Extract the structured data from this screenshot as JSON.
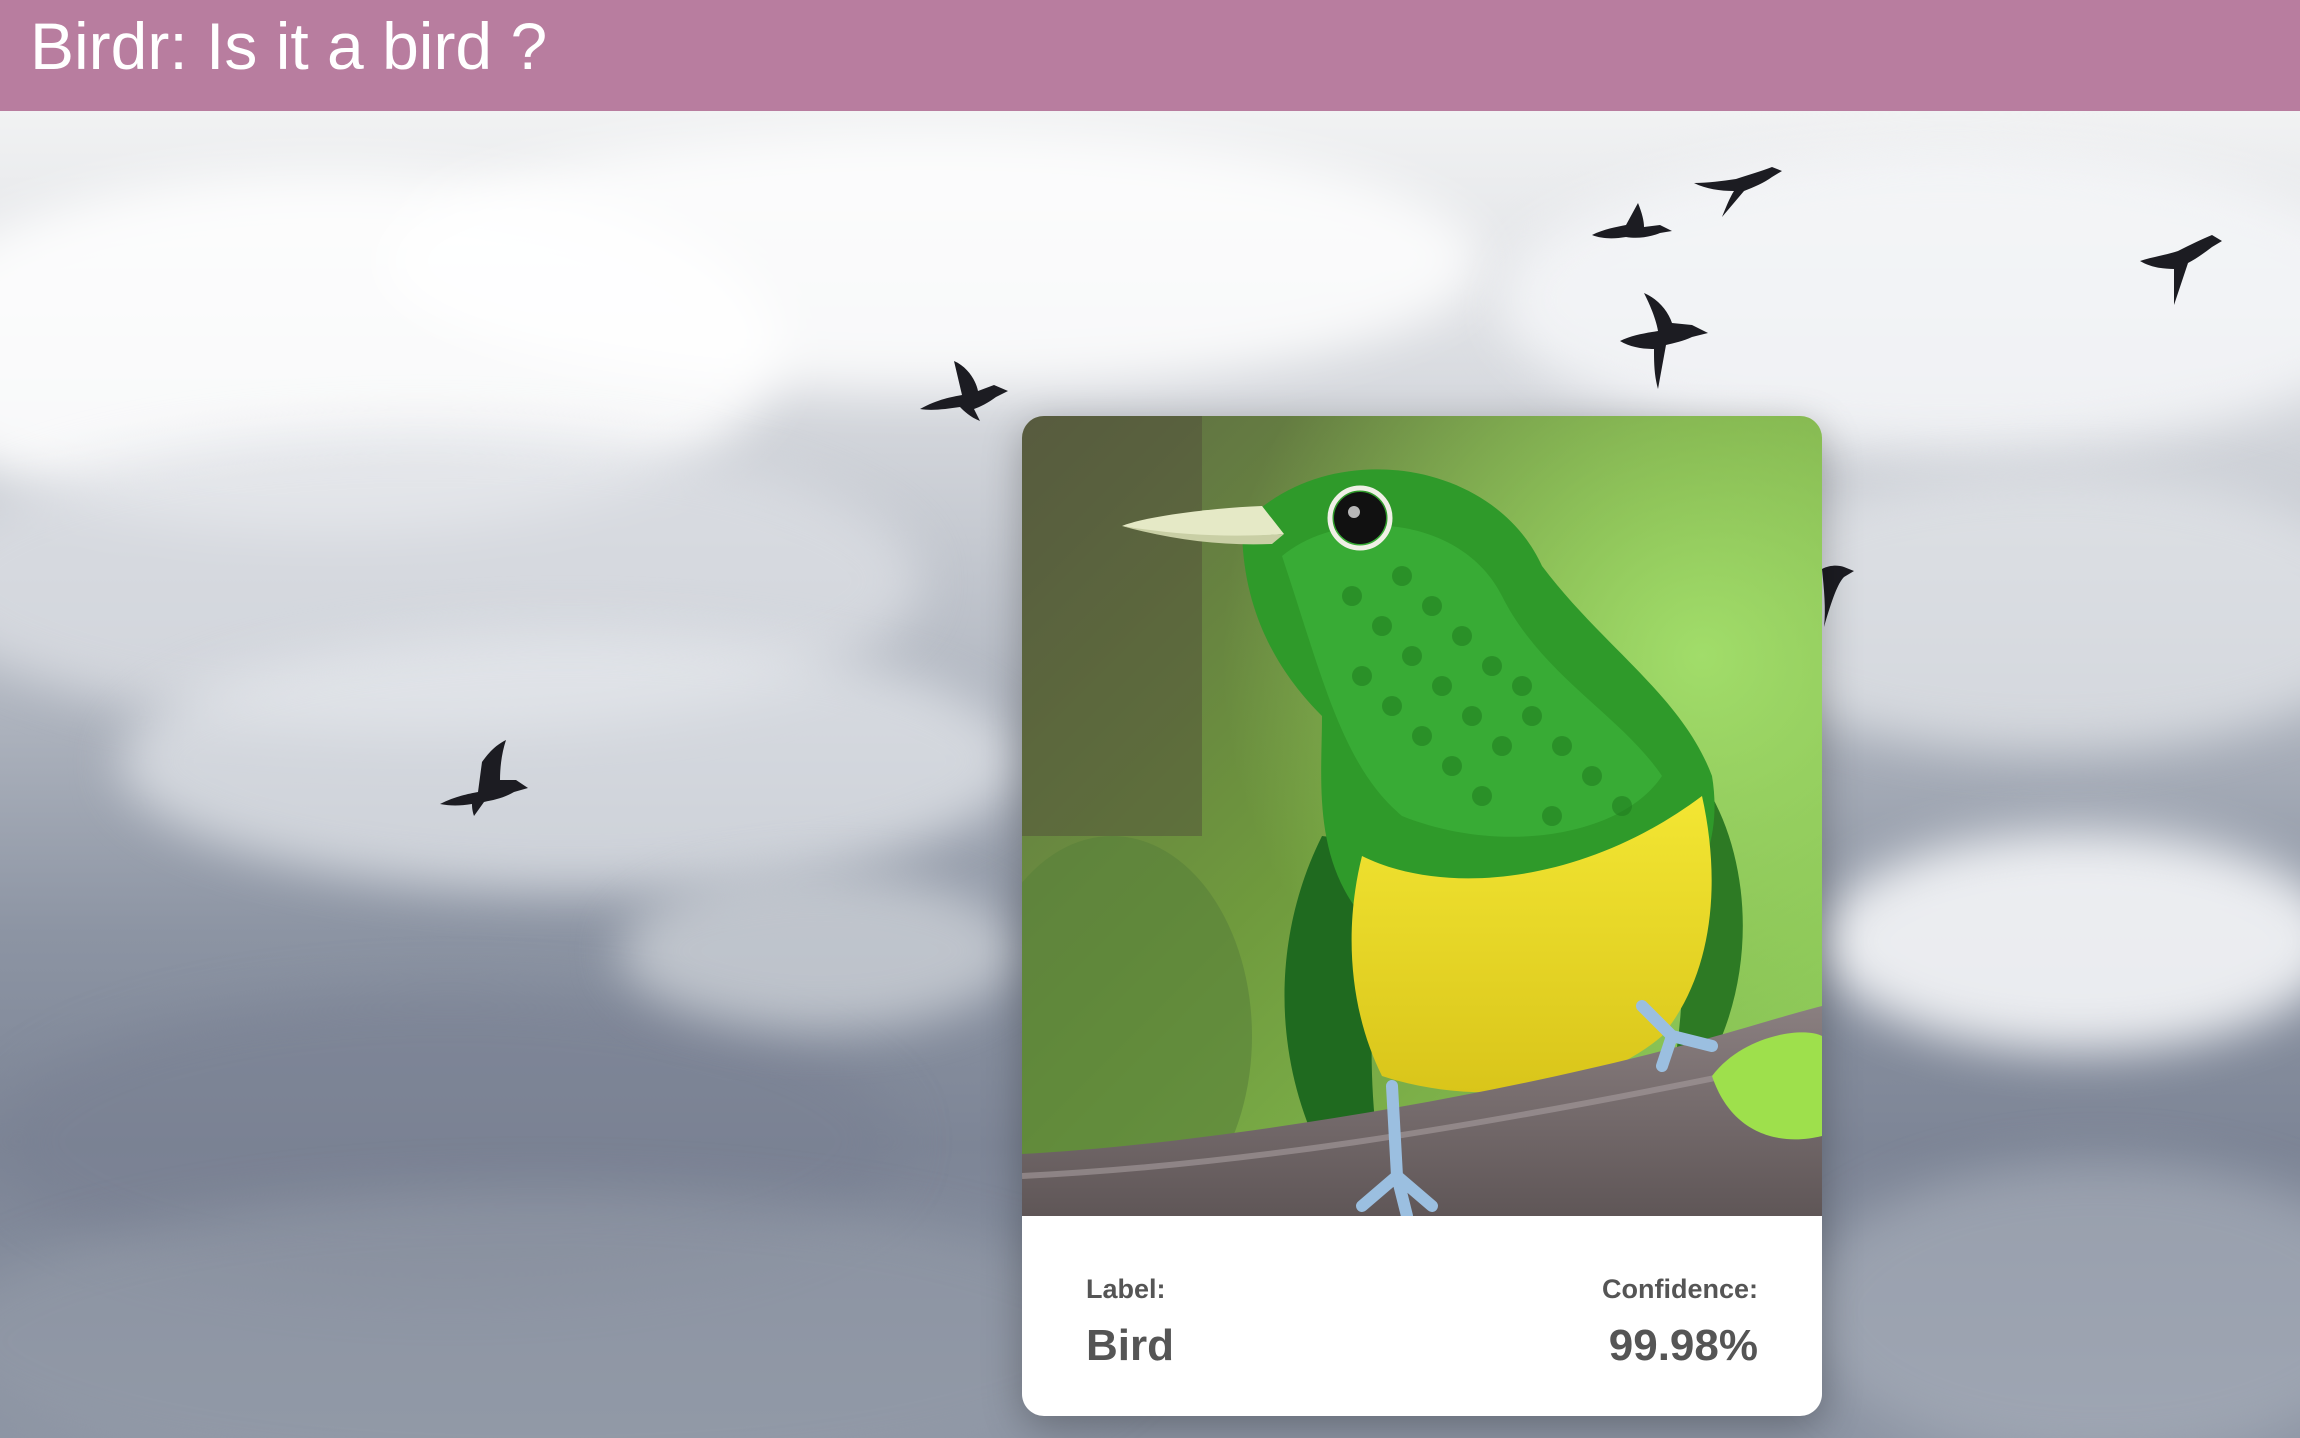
{
  "header": {
    "title": "Birdr: Is it a bird ?"
  },
  "background": {
    "description_icon": "sky-with-flying-birds-image"
  },
  "result_card": {
    "image_icon": "green-cuckoo-bird-photo",
    "label_caption": "Label:",
    "label_value": "Bird",
    "confidence_caption": "Confidence:",
    "confidence_value": "99.98%"
  },
  "colors": {
    "header_background": "#b87d9f",
    "header_text": "#ffffff",
    "card_background": "#ffffff",
    "card_text": "#555555"
  }
}
